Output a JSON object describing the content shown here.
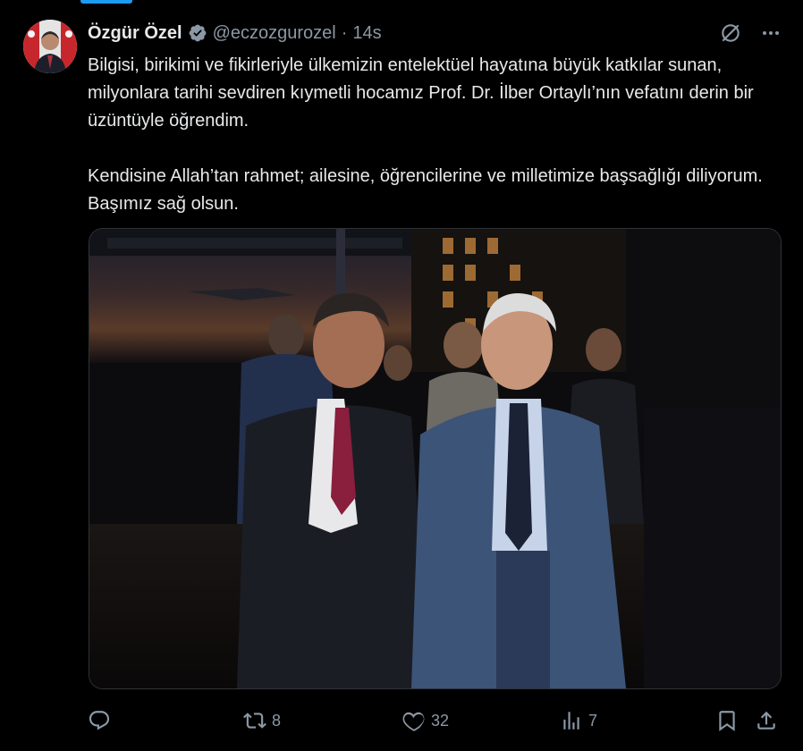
{
  "tweet": {
    "author_name": "Özgür Özel",
    "handle": "@eczozgurozel",
    "separator": "·",
    "time": "14s",
    "paragraphs": [
      "Bilgisi, birikimi ve fikirleriyle ülkemizin entelektüel hayatına büyük katkılar sunan, milyonlara tarihi sevdiren kıymetli hocamız Prof. Dr. İlber Ortaylı’nın vefatını derin bir üzüntüyle öğrendim.",
      "Kendisine Allah’tan rahmet; ailesine, öğrencilerine ve milletimize başsağlığı diliyorum. Başımız sağ olsun."
    ]
  },
  "actions": {
    "reply_count": "",
    "retweet_count": "8",
    "like_count": "32",
    "views_count": "7"
  },
  "icons": {
    "avatar": "avatar-photo",
    "verified": "verified-badge-icon",
    "grok": "grok-icon",
    "more": "more-icon",
    "reply": "reply-icon",
    "retweet": "retweet-icon",
    "like": "like-icon",
    "views": "views-icon",
    "bookmark": "bookmark-icon",
    "share": "share-icon"
  },
  "colors": {
    "background": "#000000",
    "text": "#e7e9ea",
    "secondary": "#8b98a5",
    "accent": "#1d9bf0"
  }
}
